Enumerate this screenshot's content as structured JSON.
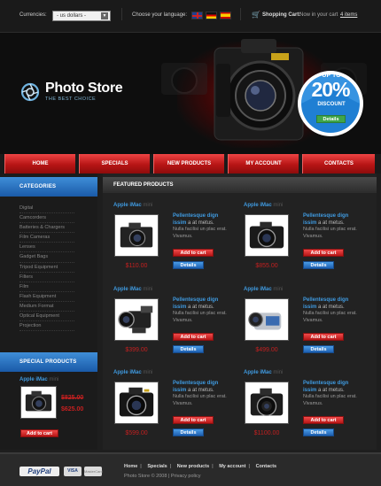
{
  "topbar": {
    "currency_label": "Currencies:",
    "currency_value": "- us dollars -",
    "language_label": "Choose your language:",
    "languages": [
      "English",
      "Deutsch",
      "Español"
    ],
    "cart_label": "Shopping Cart:",
    "cart_now": "Now in your cart",
    "cart_items": "4 items"
  },
  "header": {
    "logo_title": "Photo Store",
    "logo_subtitle": "THE BEST CHOICE",
    "promo": {
      "up_to": "UP TO",
      "percent": "20%",
      "discount": "DISCOUNT",
      "details": "Details"
    }
  },
  "nav": {
    "items": [
      "HOME",
      "SPECIALS",
      "NEW PRODUCTS",
      "MY ACCOUNT",
      "CONTACTS"
    ]
  },
  "sidebar": {
    "categories_title": "CATEGORIES",
    "categories": [
      "Digital",
      "Camcorders",
      "Batteries & Chargers",
      "Film Cameras",
      "Lenses",
      "Gadget Bags",
      "Tripod Equipment",
      "Filters",
      "Film",
      "Flash Equipment",
      "Medium Format",
      "Optical Equipment",
      "Projection"
    ],
    "specials_title": "SPECIAL PRODUCTS",
    "special": {
      "name": "Apple iMac",
      "tag": "mini",
      "old_price": "$825.00",
      "new_price": "$625.00",
      "cart": "Add to cart"
    }
  },
  "main": {
    "title": "FEATURED PRODUCTS",
    "desc_title": "Pellentesque dign issim",
    "desc_title_rest": "a at metus.",
    "desc_body": "Nulla facilisi un plac erat. Vivamus.",
    "cart_label": "Add to cart",
    "details_label": "Details",
    "products": [
      {
        "name": "Apple iMac",
        "tag": "mini",
        "price": "$110.00",
        "icon": "camera-icon"
      },
      {
        "name": "Apple iMac",
        "tag": "mini",
        "price": "$855.00",
        "icon": "camera-icon"
      },
      {
        "name": "Apple iMac",
        "tag": "mini",
        "price": "$399.00",
        "icon": "camcorder-icon"
      },
      {
        "name": "Apple iMac",
        "tag": "mini",
        "price": "$499.00",
        "icon": "camcorder-icon"
      },
      {
        "name": "Apple iMac",
        "tag": "mini",
        "price": "$599.00",
        "icon": "camera-icon"
      },
      {
        "name": "Apple iMac",
        "tag": "mini",
        "price": "$1100.00",
        "icon": "camera-icon"
      }
    ]
  },
  "footer": {
    "paypal": "PayPal",
    "visa": "VISA",
    "mastercard": "MasterCard",
    "links": [
      "Home",
      "Specials",
      "New products",
      "My account",
      "Contacts"
    ],
    "copyright": "Photo Store © 2008 | Privacy policy"
  },
  "colors": {
    "accent_red": "#c42020",
    "accent_blue": "#3f9ae0",
    "background": "#1e1e1e"
  }
}
